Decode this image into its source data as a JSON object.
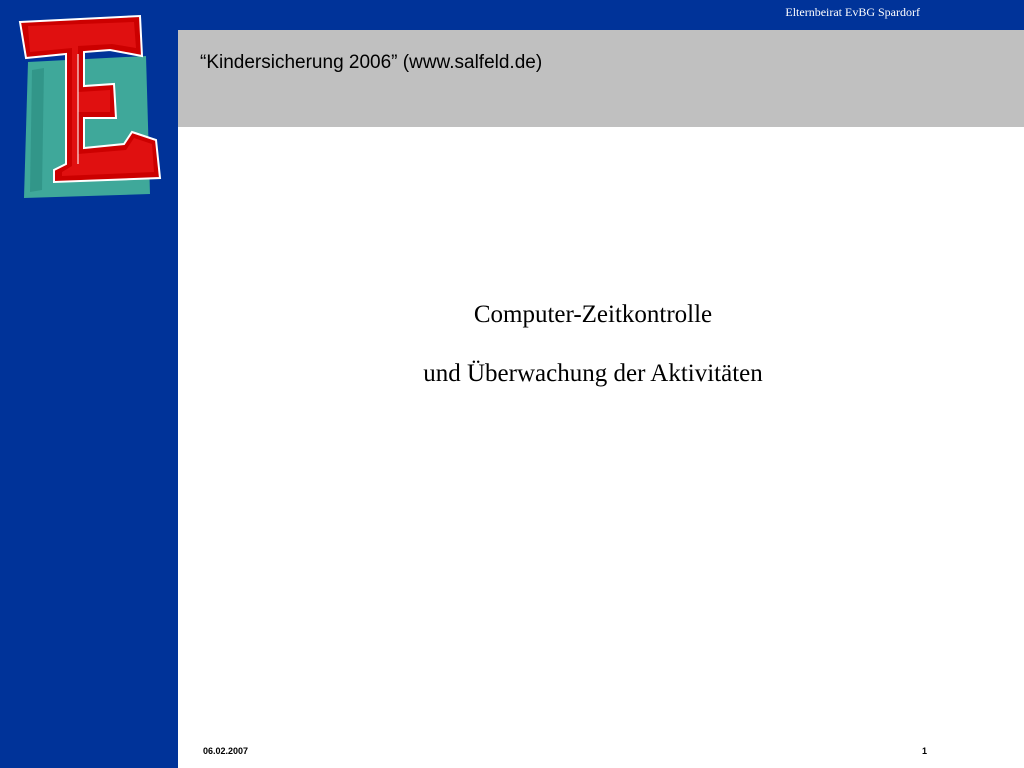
{
  "header": {
    "organization": "Elternbeirat EvBG Spardorf",
    "title": "“Kindersicherung 2006” (www.salfeld.de)"
  },
  "logo": {
    "letter": "E",
    "colors": {
      "letter": "#cc0000",
      "background_square": "#3fa89a"
    }
  },
  "content": {
    "lines": [
      "Computer-Zeitkontrolle",
      "und Überwachung der Aktivitäten"
    ]
  },
  "footer": {
    "date": "06.02.2007",
    "page_number": "1"
  },
  "colors": {
    "sidebar": "#003399",
    "title_bar": "#c0c0c0",
    "background": "#ffffff"
  }
}
